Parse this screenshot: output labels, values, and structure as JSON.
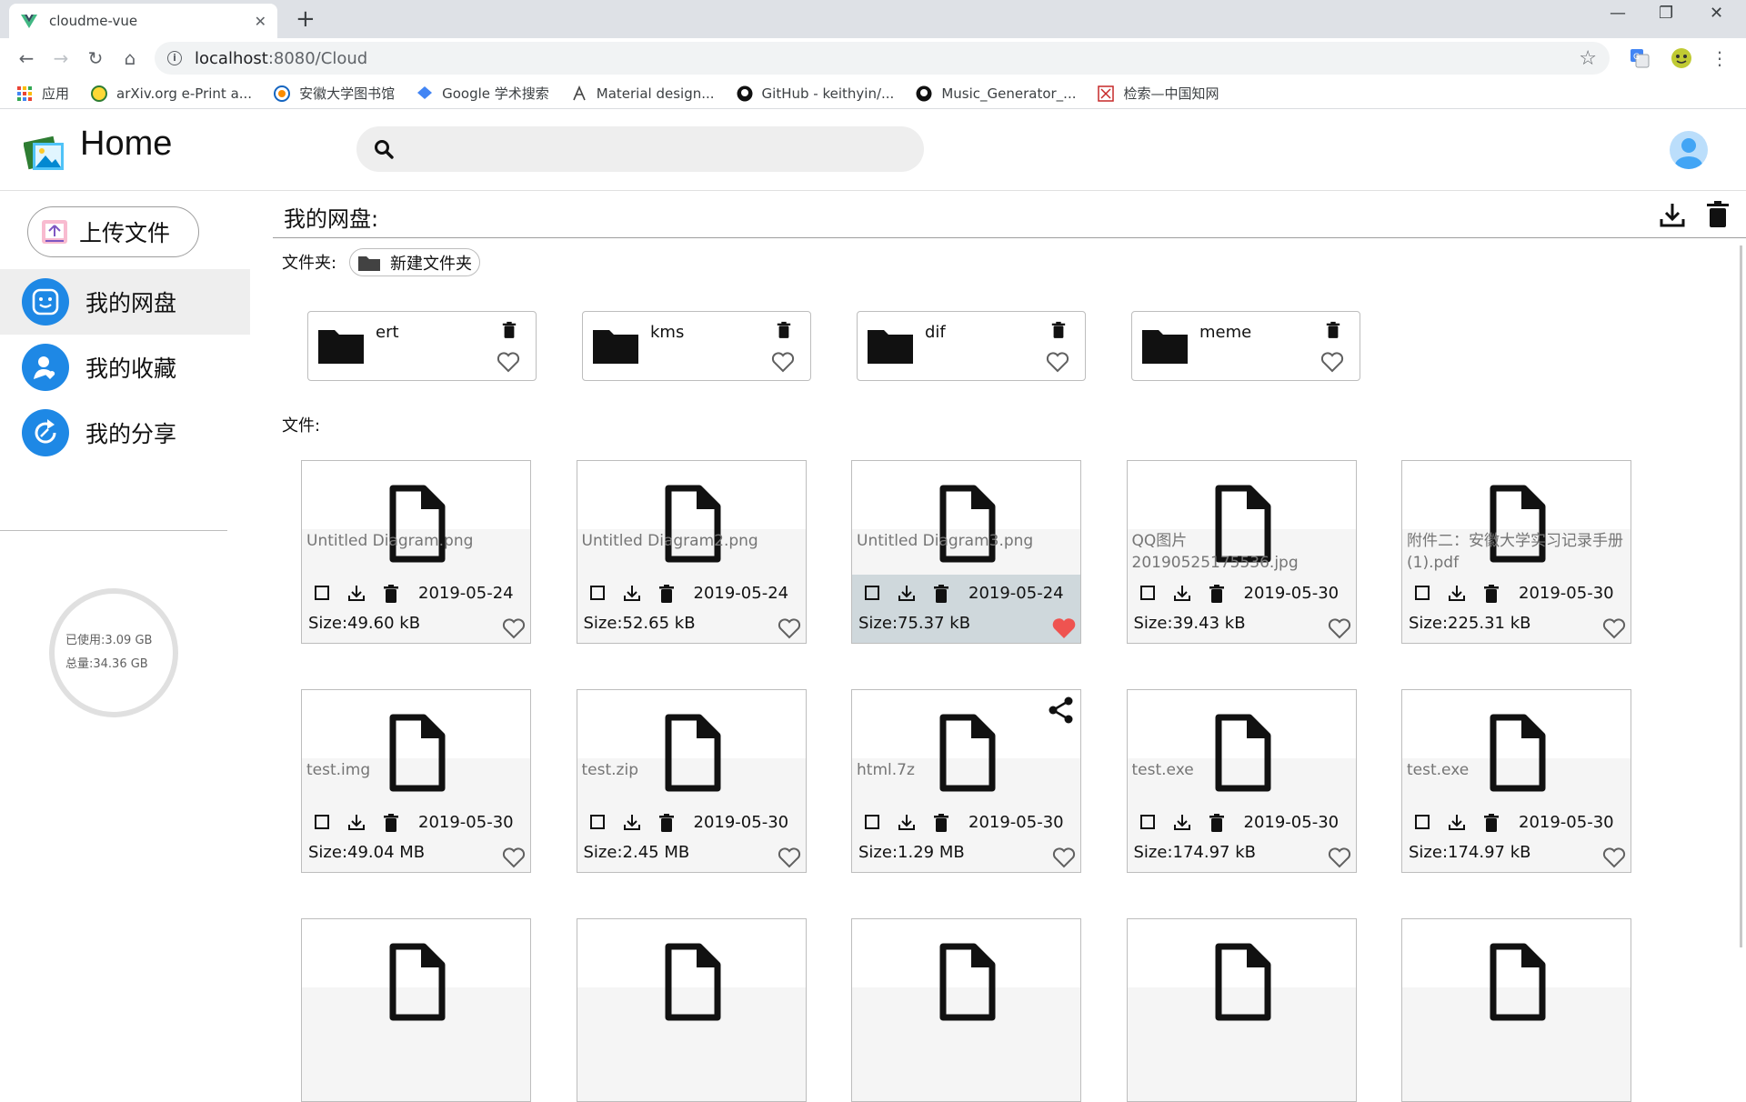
{
  "browser": {
    "tab_title": "cloudme-vue",
    "url_host": "localhost",
    "url_path": ":8080/Cloud",
    "bookmarks": [
      {
        "label": "应用",
        "icon": "apps-grid-icon"
      },
      {
        "label": "arXiv.org e-Print a...",
        "icon": "arxiv-icon"
      },
      {
        "label": "安徽大学图书馆",
        "icon": "library-icon"
      },
      {
        "label": "Google 学术搜索",
        "icon": "scholar-icon"
      },
      {
        "label": "Material design...",
        "icon": "material-icon"
      },
      {
        "label": "GitHub - keithyin/...",
        "icon": "github-icon"
      },
      {
        "label": "Music_Generator_...",
        "icon": "github-icon"
      },
      {
        "label": "检索—中国知网",
        "icon": "cnki-icon"
      }
    ]
  },
  "header": {
    "title": "Home",
    "search_placeholder": ""
  },
  "sidebar": {
    "upload_label": "上传文件",
    "items": [
      {
        "label": "我的网盘",
        "icon": "smile-icon",
        "active": true
      },
      {
        "label": "我的收藏",
        "icon": "user-heart-icon",
        "active": false
      },
      {
        "label": "我的分享",
        "icon": "share-refresh-icon",
        "active": false
      }
    ],
    "usage": {
      "used": "已使用:3.09 GB",
      "total": "总量:34.36 GB"
    }
  },
  "main": {
    "title": "我的网盘:",
    "folders_label": "文件夹:",
    "new_folder_label": "新建文件夹",
    "folders": [
      {
        "name": "ert",
        "favorite": false
      },
      {
        "name": "kms",
        "favorite": false
      },
      {
        "name": "dif",
        "favorite": false
      },
      {
        "name": "meme",
        "favorite": false
      }
    ],
    "files_label": "文件:",
    "files": [
      {
        "name": "Untitled Diagram.png",
        "date": "2019-05-24",
        "size": "Size:49.60 kB",
        "favorite": false,
        "selected": false,
        "shared": false
      },
      {
        "name": "Untitled Diagram2.png",
        "date": "2019-05-24",
        "size": "Size:52.65 kB",
        "favorite": false,
        "selected": false,
        "shared": false
      },
      {
        "name": "Untitled Diagram3.png",
        "date": "2019-05-24",
        "size": "Size:75.37 kB",
        "favorite": true,
        "selected": true,
        "shared": false
      },
      {
        "name": "QQ图片20190525175536.jpg",
        "date": "2019-05-30",
        "size": "Size:39.43 kB",
        "favorite": false,
        "selected": false,
        "shared": false
      },
      {
        "name": "附件二：安徽大学实习记录手册(1).pdf",
        "date": "2019-05-30",
        "size": "Size:225.31 kB",
        "favorite": false,
        "selected": false,
        "shared": false
      },
      {
        "name": "test.img",
        "date": "2019-05-30",
        "size": "Size:49.04 MB",
        "favorite": false,
        "selected": false,
        "shared": false
      },
      {
        "name": "test.zip",
        "date": "2019-05-30",
        "size": "Size:2.45 MB",
        "favorite": false,
        "selected": false,
        "shared": false
      },
      {
        "name": "html.7z",
        "date": "2019-05-30",
        "size": "Size:1.29 MB",
        "favorite": false,
        "selected": false,
        "shared": true
      },
      {
        "name": "test.exe",
        "date": "2019-05-30",
        "size": "Size:174.97 kB",
        "favorite": false,
        "selected": false,
        "shared": false
      },
      {
        "name": "test.exe",
        "date": "2019-05-30",
        "size": "Size:174.97 kB",
        "favorite": false,
        "selected": false,
        "shared": false
      }
    ]
  },
  "colors": {
    "accent": "#1e88e5",
    "favorite": "#ef5350",
    "selected_bg": "#cfd8dc"
  }
}
